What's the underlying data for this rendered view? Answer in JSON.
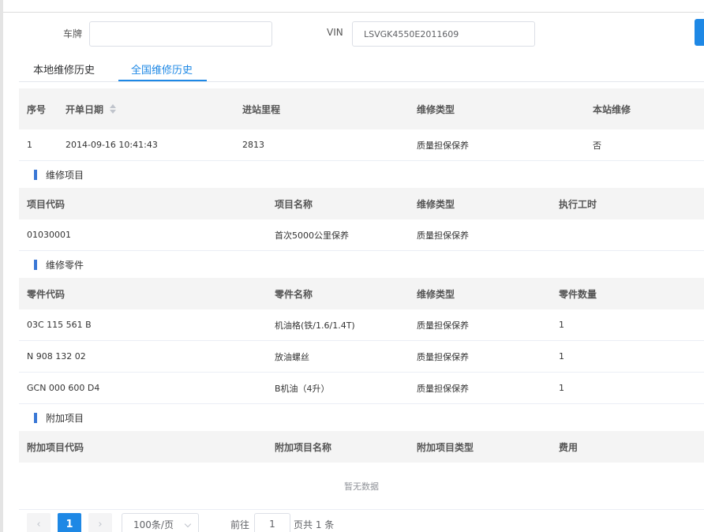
{
  "search": {
    "plate_label": "车牌",
    "plate_value": "",
    "vin_label": "VIN",
    "vin_value": "LSVGK4550E2011609"
  },
  "tabs": [
    {
      "label": "本地维修历史",
      "active": false
    },
    {
      "label": "全国维修历史",
      "active": true
    }
  ],
  "history_table": {
    "columns": [
      "序号",
      "开单日期",
      "进站里程",
      "维修类型",
      "本站维修"
    ],
    "rows": [
      {
        "index": "1",
        "date": "2014-09-16 10:41:43",
        "mileage": "2813",
        "type": "质量担保保养",
        "local": "否"
      }
    ]
  },
  "repair_items": {
    "title": "维修项目",
    "columns": [
      "项目代码",
      "项目名称",
      "维修类型",
      "执行工时"
    ],
    "rows": [
      {
        "code": "01030001",
        "name": "首次5000公里保养",
        "type": "质量担保保养",
        "hours": ""
      }
    ]
  },
  "repair_parts": {
    "title": "维修零件",
    "columns": [
      "零件代码",
      "零件名称",
      "维修类型",
      "零件数量"
    ],
    "rows": [
      {
        "code": "03C 115 561 B",
        "name": "机油格(铁/1.6/1.4T)",
        "type": "质量担保保养",
        "qty": "1"
      },
      {
        "code": "N 908 132 02",
        "name": "放油螺丝",
        "type": "质量担保保养",
        "qty": "1"
      },
      {
        "code": "GCN 000 600 D4",
        "name": "B机油（4升）",
        "type": "质量担保保养",
        "qty": "1"
      }
    ]
  },
  "extra_items": {
    "title": "附加项目",
    "columns": [
      "附加项目代码",
      "附加项目名称",
      "附加项目类型",
      "费用"
    ],
    "empty_text": "暂无数据"
  },
  "pagination": {
    "prev_icon": "chevron-left-icon",
    "next_icon": "chevron-right-icon",
    "current_page": "1",
    "page_size": "100条/页",
    "goto_prefix": "前往",
    "goto_value": "1",
    "goto_suffix": "页共 1 条"
  },
  "colors": {
    "accent": "#1e88e5",
    "section_bar": "#3a78d6",
    "header_bg": "#f4f4f4"
  }
}
